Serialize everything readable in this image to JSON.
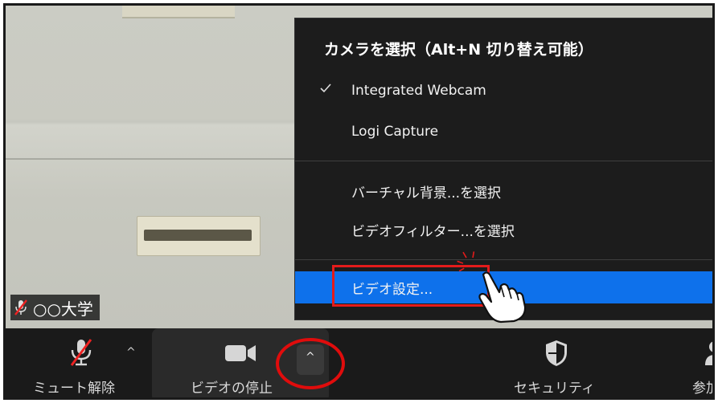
{
  "preview": {
    "participant_name": "○○大学"
  },
  "camera_menu": {
    "header": "カメラを選択（Alt+N 切り替え可能）",
    "cameras": [
      {
        "label": "Integrated Webcam",
        "checked": true
      },
      {
        "label": "Logi Capture",
        "checked": false
      }
    ],
    "options": [
      {
        "label": "バーチャル背景...を選択"
      },
      {
        "label": "ビデオフィルター...を選択"
      }
    ],
    "settings": {
      "label": "ビデオ設定...",
      "highlighted": true
    }
  },
  "toolbar": {
    "mute_label": "ミュート解除",
    "video_label": "ビデオの停止",
    "security_label": "セキュリティ",
    "participants_label": "参加"
  },
  "colors": {
    "highlight": "#0e71eb",
    "annotation_red": "#e41b1b"
  }
}
